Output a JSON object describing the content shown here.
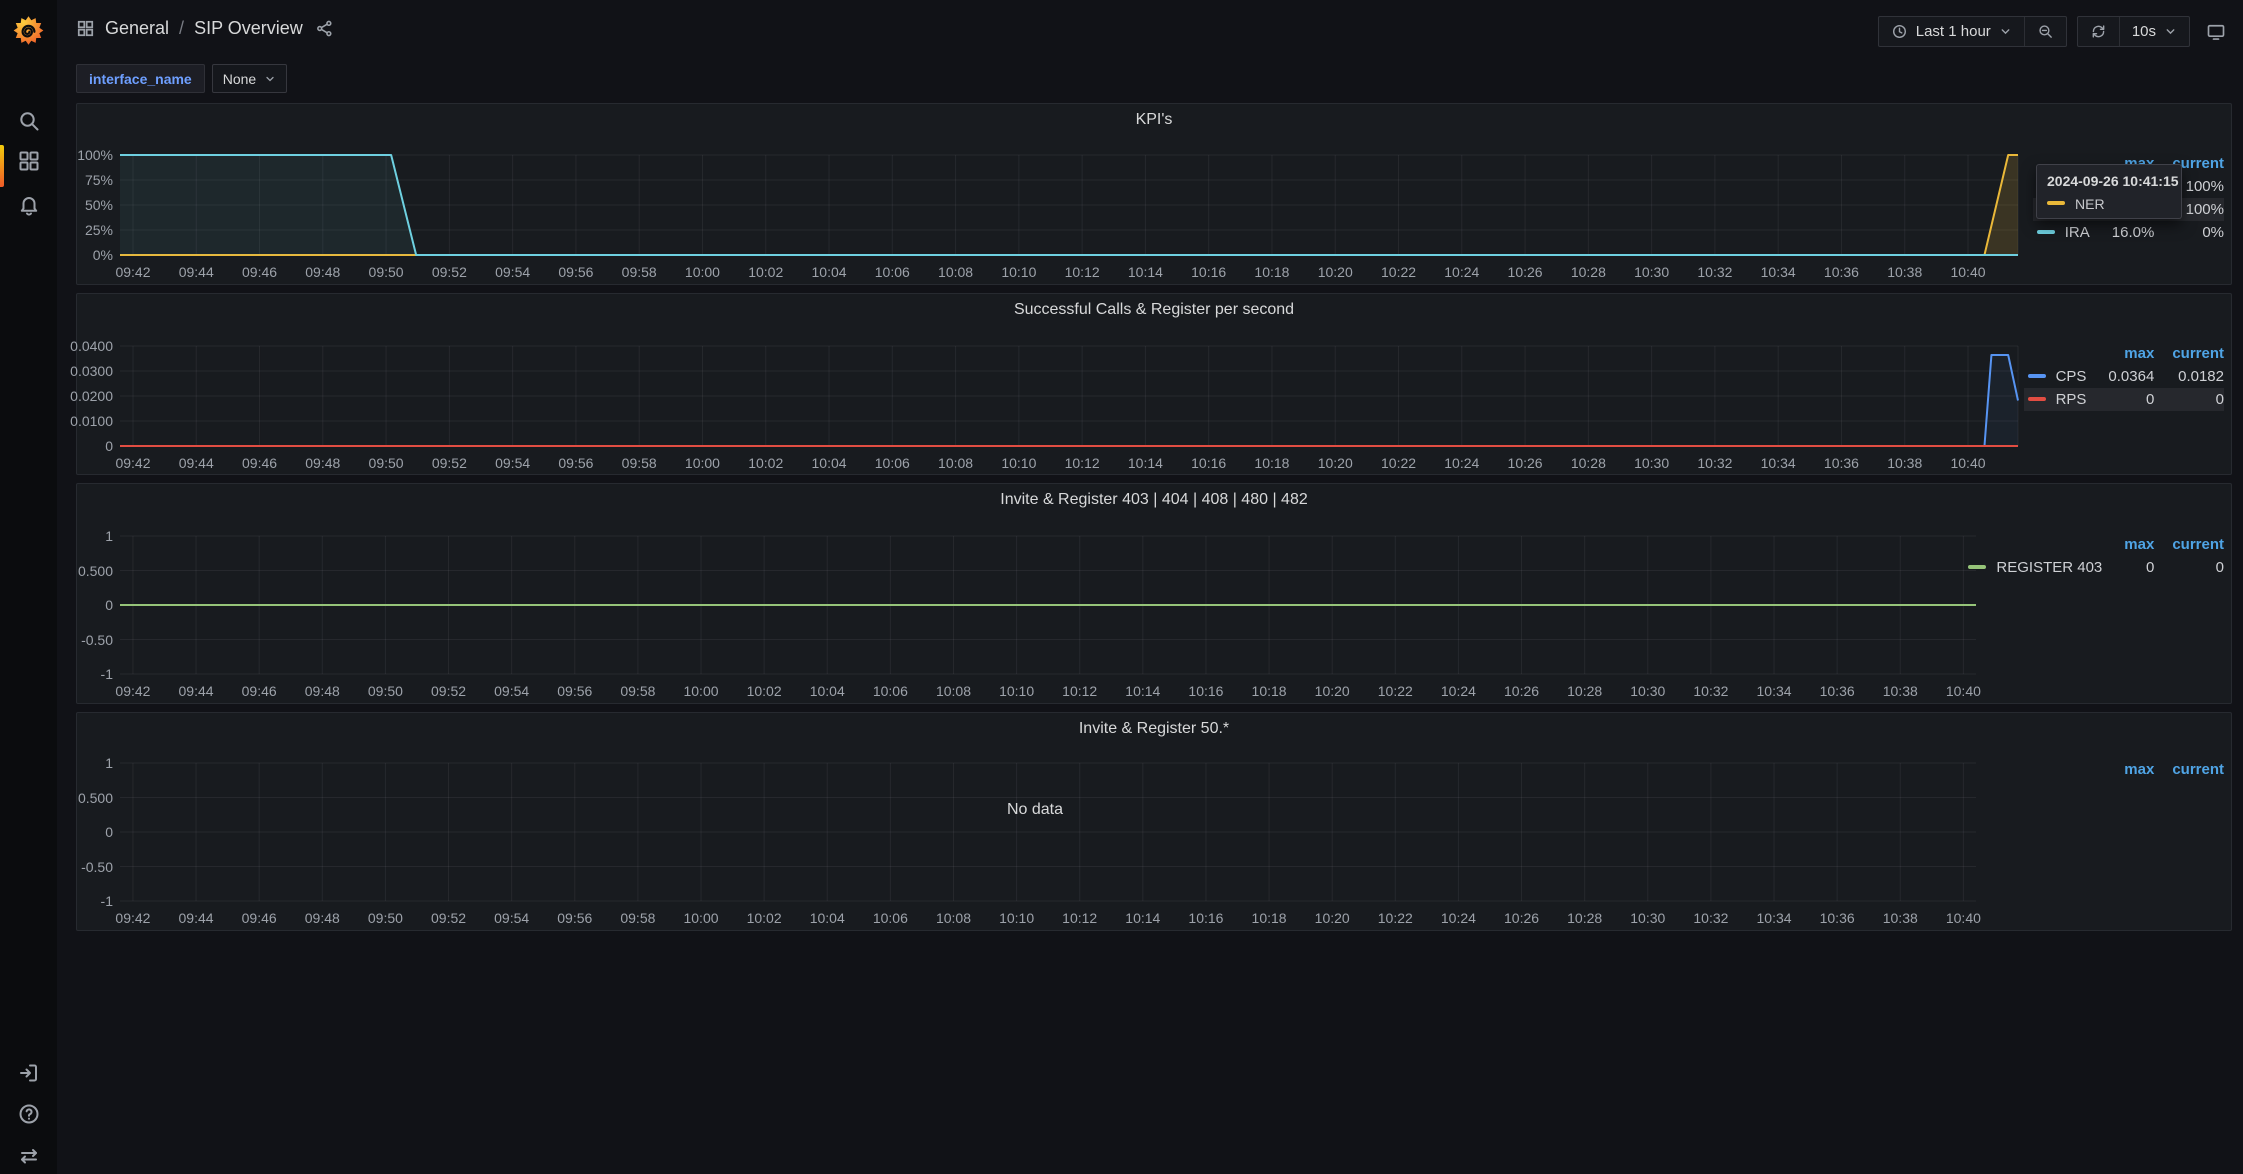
{
  "window": {
    "breadcrumb_section": "General",
    "breadcrumb_sep": "/",
    "breadcrumb_page": "SIP Overview"
  },
  "topbar": {
    "time_range_label": "Last 1 hour",
    "refresh_interval": "10s",
    "icons": [
      "clock-icon",
      "chevron-down-icon",
      "magnifier-zoom-out-icon",
      "refresh-icon",
      "monitor-icon",
      "share-icon",
      "apps-grid-icon"
    ]
  },
  "sidebar": {
    "icons_top": [
      "grafana-logo",
      "search-icon",
      "dashboards-grid-icon",
      "alerting-bell-icon"
    ],
    "icons_bottom": [
      "sign-in-icon",
      "help-circle-icon",
      "swap-arrows-icon"
    ],
    "accent_color": "#F05A28"
  },
  "variables": {
    "name": "interface_name",
    "value": "None"
  },
  "colors": {
    "page_bg": "#111217",
    "panel_bg": "#181B1F",
    "sidebar_bg": "#0B0C0E",
    "legend_header_blue": "#4FA4E5",
    "variable_blue": "#6E9FFF",
    "yellow": "#EAB839",
    "cyan": "#6ED0E0",
    "blue": "#5794F2",
    "red": "#E24D42",
    "green": "#96C479"
  },
  "panels": [
    {
      "legend": {
        "headers": [
          "max",
          "current"
        ],
        "rows": [
          {
            "label": "",
            "color": "#EAB839",
            "max": "",
            "current": "100%",
            "highlight": false
          },
          {
            "label": "",
            "color": "#6ED0E0",
            "max": "",
            "current": "100%",
            "highlight": true
          },
          {
            "label": "IRA",
            "color": "#6ED0E0",
            "max": "16.0%",
            "current": "0%",
            "highlight": false
          }
        ]
      },
      "tooltip": {
        "timestamp": "2024-09-26 10:41:15",
        "series": "NER",
        "color": "#EAB839"
      }
    },
    {
      "legend": {
        "headers": [
          "max",
          "current"
        ],
        "rows": [
          {
            "label": "CPS",
            "color": "#5794F2",
            "max": "0.0364",
            "current": "0.0182",
            "highlight": false
          },
          {
            "label": "RPS",
            "color": "#E24D42",
            "max": "0",
            "current": "0",
            "highlight": true
          }
        ]
      }
    },
    {
      "legend": {
        "headers": [
          "max",
          "current"
        ],
        "rows": [
          {
            "label": "REGISTER 403",
            "color": "#96C479",
            "max": "0",
            "current": "0",
            "highlight": false
          }
        ]
      }
    },
    {
      "legend": {
        "headers": [
          "max",
          "current"
        ],
        "rows": []
      },
      "no_data": "No data"
    }
  ],
  "chart_data": [
    {
      "type": "line",
      "title": "KPI's",
      "ylim": [
        0,
        100
      ],
      "xlim_minutes": [
        -0.41,
        59.58
      ],
      "y_ticks": [
        {
          "v": 100,
          "label": "100%"
        },
        {
          "v": 75,
          "label": "75%"
        },
        {
          "v": 50,
          "label": "50%"
        },
        {
          "v": 25,
          "label": "25%"
        },
        {
          "v": 0,
          "label": "0%"
        }
      ],
      "x_ticks": [
        "09:42",
        "09:44",
        "09:46",
        "09:48",
        "09:50",
        "09:52",
        "09:54",
        "09:56",
        "09:58",
        "10:00",
        "10:02",
        "10:04",
        "10:06",
        "10:08",
        "10:10",
        "10:12",
        "10:14",
        "10:16",
        "10:18",
        "10:20",
        "10:22",
        "10:24",
        "10:26",
        "10:28",
        "10:30",
        "10:32",
        "10:34",
        "10:36",
        "10:38",
        "10:40"
      ],
      "legend_position": "right",
      "grid": true,
      "series": [
        {
          "name": "NER",
          "color": "#EAB839",
          "fill_opacity": 0.16,
          "points": [
            [
              -0.41,
              0
            ],
            [
              58.52,
              0
            ],
            [
              59.27,
              100
            ],
            [
              59.58,
              100
            ]
          ]
        },
        {
          "name": "",
          "color": "#6ED0E0",
          "fill_opacity": 0.07,
          "points": [
            [
              -0.41,
              100
            ],
            [
              8.16,
              100
            ],
            [
              8.95,
              0
            ],
            [
              59.58,
              0
            ]
          ]
        }
      ]
    },
    {
      "type": "line",
      "title": "Successful Calls & Register per second",
      "ylim": [
        0,
        0.04
      ],
      "xlim_minutes": [
        -0.41,
        59.58
      ],
      "y_ticks": [
        {
          "v": 0.04,
          "label": "0.0400"
        },
        {
          "v": 0.03,
          "label": "0.0300"
        },
        {
          "v": 0.02,
          "label": "0.0200"
        },
        {
          "v": 0.01,
          "label": "0.0100"
        },
        {
          "v": 0,
          "label": "0"
        }
      ],
      "x_ticks": [
        "09:42",
        "09:44",
        "09:46",
        "09:48",
        "09:50",
        "09:52",
        "09:54",
        "09:56",
        "09:58",
        "10:00",
        "10:02",
        "10:04",
        "10:06",
        "10:08",
        "10:10",
        "10:12",
        "10:14",
        "10:16",
        "10:18",
        "10:20",
        "10:22",
        "10:24",
        "10:26",
        "10:28",
        "10:30",
        "10:32",
        "10:34",
        "10:36",
        "10:38",
        "10:40"
      ],
      "legend_position": "right",
      "grid": true,
      "series": [
        {
          "name": "CPS",
          "color": "#5794F2",
          "fill_opacity": 0.06,
          "points": [
            [
              -0.41,
              0
            ],
            [
              58.52,
              0
            ],
            [
              58.74,
              0.0364
            ],
            [
              59.27,
              0.0364
            ],
            [
              59.58,
              0.0182
            ]
          ]
        },
        {
          "name": "RPS",
          "color": "#E24D42",
          "fill_opacity": 0,
          "points": [
            [
              -0.41,
              0
            ],
            [
              59.58,
              0
            ]
          ]
        }
      ]
    },
    {
      "type": "line",
      "title": "Invite & Register 403 | 404 | 408 | 480 | 482",
      "ylim": [
        -1,
        1
      ],
      "xlim_minutes": [
        -0.41,
        58.4
      ],
      "y_ticks": [
        {
          "v": 1,
          "label": "1"
        },
        {
          "v": 0.5,
          "label": "0.500"
        },
        {
          "v": 0,
          "label": "0"
        },
        {
          "v": -0.5,
          "label": "-0.50"
        },
        {
          "v": -1,
          "label": "-1"
        }
      ],
      "x_ticks": [
        "09:42",
        "09:44",
        "09:46",
        "09:48",
        "09:50",
        "09:52",
        "09:54",
        "09:56",
        "09:58",
        "10:00",
        "10:02",
        "10:04",
        "10:06",
        "10:08",
        "10:10",
        "10:12",
        "10:14",
        "10:16",
        "10:18",
        "10:20",
        "10:22",
        "10:24",
        "10:26",
        "10:28",
        "10:30",
        "10:32",
        "10:34",
        "10:36",
        "10:38",
        "10:40"
      ],
      "legend_position": "right",
      "grid": true,
      "series": [
        {
          "name": "REGISTER 403",
          "color": "#96C479",
          "fill_opacity": 0,
          "points": [
            [
              -0.41,
              0
            ],
            [
              58.4,
              0
            ]
          ]
        }
      ]
    },
    {
      "type": "line",
      "title": "Invite & Register 50.*",
      "ylim": [
        -1,
        1
      ],
      "xlim_minutes": [
        -0.41,
        58.4
      ],
      "y_ticks": [
        {
          "v": 1,
          "label": "1"
        },
        {
          "v": 0.5,
          "label": "0.500"
        },
        {
          "v": 0,
          "label": "0"
        },
        {
          "v": -0.5,
          "label": "-0.50"
        },
        {
          "v": -1,
          "label": "-1"
        }
      ],
      "x_ticks": [
        "09:42",
        "09:44",
        "09:46",
        "09:48",
        "09:50",
        "09:52",
        "09:54",
        "09:56",
        "09:58",
        "10:00",
        "10:02",
        "10:04",
        "10:06",
        "10:08",
        "10:10",
        "10:12",
        "10:14",
        "10:16",
        "10:18",
        "10:20",
        "10:22",
        "10:24",
        "10:26",
        "10:28",
        "10:30",
        "10:32",
        "10:34",
        "10:36",
        "10:38",
        "10:40"
      ],
      "legend_position": "right",
      "grid": true,
      "no_data": "No data",
      "series": []
    }
  ]
}
